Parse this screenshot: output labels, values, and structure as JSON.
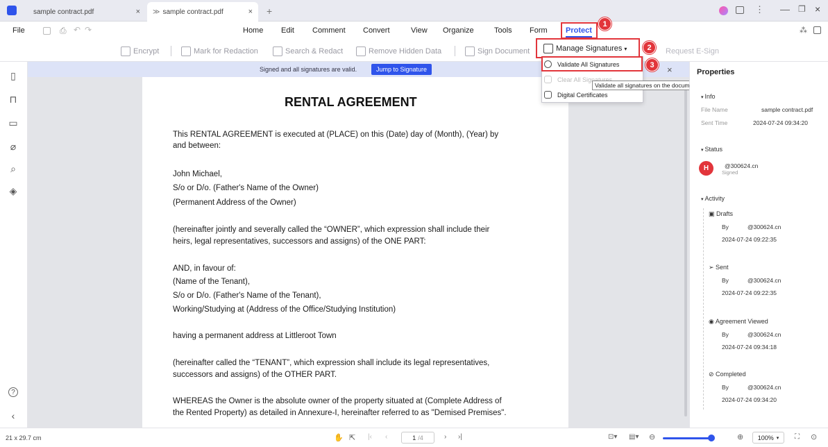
{
  "tabs": [
    {
      "label": "sample contract.pdf"
    },
    {
      "label": "sample contract.pdf"
    }
  ],
  "menu": {
    "file": "File",
    "items": [
      "Home",
      "Edit",
      "Comment",
      "Convert",
      "View",
      "Organize",
      "Tools",
      "Form",
      "Protect"
    ]
  },
  "toolbar": {
    "encrypt": "Encrypt",
    "mark_redaction": "Mark for Redaction",
    "search_redact": "Search & Redact",
    "remove_hidden": "Remove Hidden Data",
    "sign_document": "Sign Document",
    "manage_signatures": "Manage Signatures",
    "request_esign": "Request E-Sign"
  },
  "dropdown": {
    "validate": "Validate All Signatures",
    "clear": "Clear All Signatures",
    "digital_certs": "Digital Certificates"
  },
  "tooltip": "Validate all signatures on the document",
  "badges": [
    "1",
    "2",
    "3"
  ],
  "banner": {
    "text": "Signed and all signatures are valid.",
    "button": "Jump to Signature"
  },
  "document": {
    "title": "RENTAL AGREEMENT",
    "paragraphs": [
      "This RENTAL AGREEMENT is executed at (PLACE) on this (Date) day of (Month), (Year) by",
      "and between:",
      "John Michael,",
      "S/o or D/o. (Father's Name of the Owner)",
      "(Permanent Address of the Owner)",
      "(hereinafter jointly and severally called the “OWNER”, which expression shall include their",
      "heirs, legal representatives, successors and assigns) of the ONE PART:",
      "AND, in favour of:",
      "(Name of the Tenant),",
      "S/o or D/o. (Father's Name of the Tenant),",
      "Working/Studying at (Address of the Office/Studying Institution)",
      "having a permanent address at Littleroot Town",
      "(hereinafter called the “TENANT”, which expression shall include its legal representatives,",
      "successors and assigns) of the OTHER PART.",
      "WHEREAS the Owner is the absolute owner of the property situated at (Complete Address of",
      "the Rented Property) as detailed in Annexure-I, hereinafter referred to as \"Demised Premises\"."
    ]
  },
  "properties": {
    "title": "Properties",
    "info_label": "Info",
    "file_name_label": "File Name",
    "file_name": "sample contract.pdf",
    "sent_time_label": "Sent Time",
    "sent_time": "2024-07-24 09:34:20",
    "status_label": "Status",
    "avatar_initial": "H",
    "status_email": "@300624.cn",
    "status_state": "Signed",
    "activity_label": "Activity",
    "by_label": "By",
    "activities": [
      {
        "name": "Drafts",
        "by": "@300624.cn",
        "time": "2024-07-24 09:22:35"
      },
      {
        "name": "Sent",
        "by": "@300624.cn",
        "time": "2024-07-24 09:22:35"
      },
      {
        "name": "Agreement Viewed",
        "by": "@300624.cn",
        "time": "2024-07-24 09:34:18"
      },
      {
        "name": "Completed",
        "by": "@300624.cn",
        "time": "2024-07-24 09:34:20"
      }
    ]
  },
  "statusbar": {
    "page_size": "21 x 29.7 cm",
    "page_current": "1",
    "page_total": "/4",
    "zoom": "100%"
  },
  "colors": {
    "accent": "#2f54eb",
    "highlight": "#e2353b"
  }
}
